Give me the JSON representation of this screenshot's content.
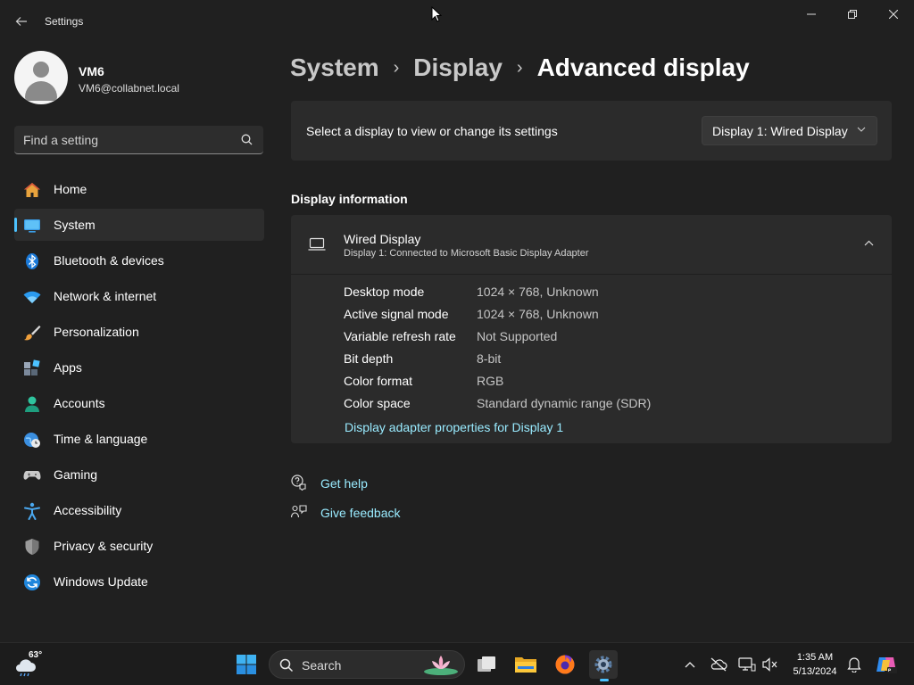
{
  "window": {
    "app_title": "Settings"
  },
  "profile": {
    "name": "VM6",
    "email": "VM6@collabnet.local"
  },
  "search": {
    "placeholder": "Find a setting"
  },
  "sidebar": {
    "items": [
      {
        "label": "Home",
        "icon": "home-icon"
      },
      {
        "label": "System",
        "icon": "system-icon",
        "active": true
      },
      {
        "label": "Bluetooth & devices",
        "icon": "bluetooth-icon"
      },
      {
        "label": "Network & internet",
        "icon": "network-icon"
      },
      {
        "label": "Personalization",
        "icon": "brush-icon"
      },
      {
        "label": "Apps",
        "icon": "apps-icon"
      },
      {
        "label": "Accounts",
        "icon": "accounts-icon"
      },
      {
        "label": "Time & language",
        "icon": "clock-globe-icon"
      },
      {
        "label": "Gaming",
        "icon": "gamepad-icon"
      },
      {
        "label": "Accessibility",
        "icon": "accessibility-icon"
      },
      {
        "label": "Privacy & security",
        "icon": "shield-icon"
      },
      {
        "label": "Windows Update",
        "icon": "update-icon"
      }
    ]
  },
  "breadcrumb": {
    "items": [
      "System",
      "Display"
    ],
    "current": "Advanced display"
  },
  "display_select": {
    "label": "Select a display to view or change its settings",
    "selected": "Display 1: Wired Display"
  },
  "display_info": {
    "section_title": "Display information",
    "name": "Wired Display",
    "subtitle": "Display 1: Connected to Microsoft Basic Display Adapter",
    "rows": [
      {
        "key": "Desktop mode",
        "value": "1024 × 768, Unknown"
      },
      {
        "key": "Active signal mode",
        "value": "1024 × 768, Unknown"
      },
      {
        "key": "Variable refresh rate",
        "value": "Not Supported"
      },
      {
        "key": "Bit depth",
        "value": "8-bit"
      },
      {
        "key": "Color format",
        "value": "RGB"
      },
      {
        "key": "Color space",
        "value": "Standard dynamic range (SDR)"
      }
    ],
    "adapter_link": "Display adapter properties for Display 1"
  },
  "help": {
    "get_help": "Get help",
    "give_feedback": "Give feedback"
  },
  "taskbar": {
    "weather_temp": "63°",
    "search_label": "Search",
    "time": "1:35 AM",
    "date": "5/13/2024"
  },
  "colors": {
    "accent": "#4cc2ff",
    "link": "#99ebff",
    "background": "#202020",
    "card": "#2b2b2b"
  }
}
